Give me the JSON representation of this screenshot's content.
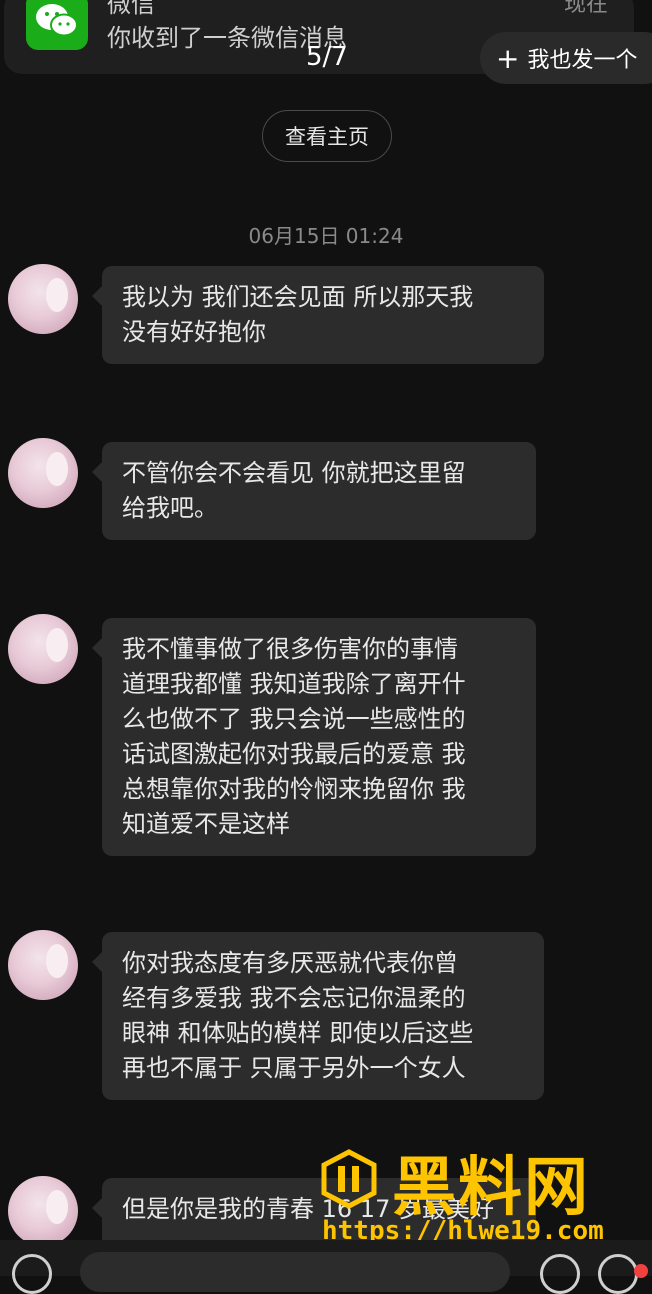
{
  "notification": {
    "app_name": "微信",
    "message": "你收到了一条微信消息",
    "time": "现在",
    "icon": "wechat-icon"
  },
  "header": {
    "counter": "5/7",
    "post_button": "我也发一个",
    "view_home_button": "查看主页"
  },
  "chat": {
    "timestamp": "06月15日 01:24",
    "messages": [
      {
        "text": "我以为 我们还会见面 所以那天我\n没有好好抱你"
      },
      {
        "text": "不管你会不会看见 你就把这里留\n给我吧。"
      },
      {
        "text": "我不懂事做了很多伤害你的事情\n道理我都懂 我知道我除了离开什\n么也做不了 我只会说一些感性的\n话试图激起你对我最后的爱意 我\n总想靠你对我的怜悯来挽留你 我\n知道爱不是这样"
      },
      {
        "text": "你对我态度有多厌恶就代表你曾\n经有多爱我 我不会忘记你温柔的\n眼神 和体贴的模样 即使以后这些\n再也不属于 只属于另外一个女人"
      },
      {
        "text": "但是你是我的青春 16 17 岁最美好"
      }
    ]
  },
  "watermark": {
    "title": "黑料网",
    "url": "https://hlwe19.com"
  },
  "colors": {
    "background": "#111111",
    "bubble": "#2c2c2c",
    "wechat_green": "#1aad19",
    "watermark": "#ffc400"
  }
}
